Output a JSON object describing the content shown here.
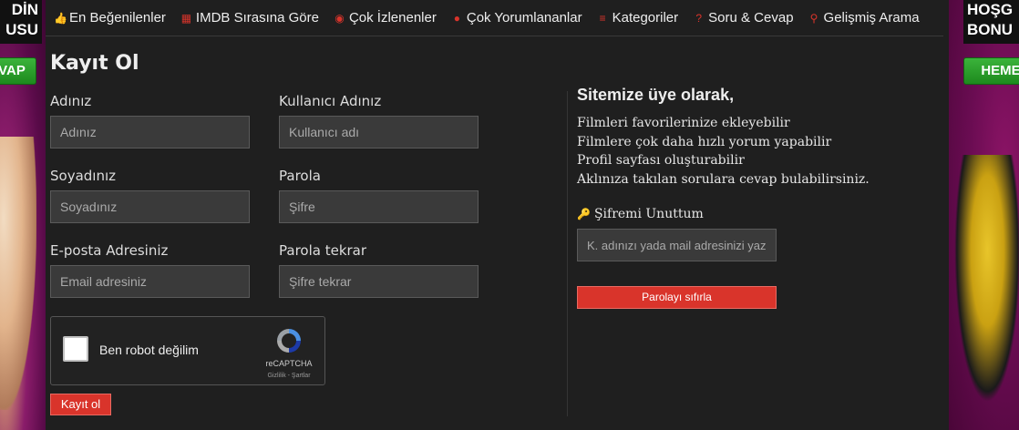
{
  "banner_left": {
    "title": "DİN\nUSU",
    "button": "VAP"
  },
  "banner_right": {
    "title": "HOŞG\nBONU",
    "button": "HEME"
  },
  "nav": [
    {
      "icon": "thumbs-up-icon",
      "glyph": "👍",
      "label": "En Beğenilenler"
    },
    {
      "icon": "film-icon",
      "glyph": "▦",
      "label": "IMDB Sırasına Göre"
    },
    {
      "icon": "eye-icon",
      "glyph": "◉",
      "label": "Çok İzlenenler"
    },
    {
      "icon": "comments-icon",
      "glyph": "●",
      "label": "Çok Yorumlananlar"
    },
    {
      "icon": "list-icon",
      "glyph": "≡",
      "label": "Kategoriler"
    },
    {
      "icon": "question-icon",
      "glyph": "?",
      "label": "Soru & Cevap"
    },
    {
      "icon": "search-icon",
      "glyph": "⚲",
      "label": "Gelişmiş Arama"
    }
  ],
  "page_title": "Kayıt Ol",
  "form": {
    "name_label": "Adınız",
    "name_placeholder": "Adınız",
    "username_label": "Kullanıcı Adınız",
    "username_placeholder": "Kullanıcı adı",
    "surname_label": "Soyadınız",
    "surname_placeholder": "Soyadınız",
    "password_label": "Parola",
    "password_placeholder": "Şifre",
    "email_label": "E-posta Adresiniz",
    "email_placeholder": "Email adresiniz",
    "password2_label": "Parola tekrar",
    "password2_placeholder": "Şifre tekrar",
    "submit": "Kayıt ol"
  },
  "recaptcha": {
    "label": "Ben robot değilim",
    "brand": "reCAPTCHA",
    "terms": "Gizlilik - Şartlar"
  },
  "info": {
    "title": "Sitemize üye olarak,",
    "benefits": [
      "Filmleri favorilerinize ekleyebilir",
      "Filmlere çok daha hızlı yorum yapabilir",
      "Profil sayfası oluşturabilir",
      "Aklınıza takılan sorulara cevap bulabilirsiniz."
    ],
    "forgot_title": "Şifremi Unuttum",
    "forgot_placeholder": "K. adınızı yada mail adresinizi yazın",
    "reset_button": "Parolayı sıfırla"
  },
  "colors": {
    "accent": "#d9342b",
    "background": "#1f1f1f",
    "input_bg": "#3a3a3a"
  }
}
